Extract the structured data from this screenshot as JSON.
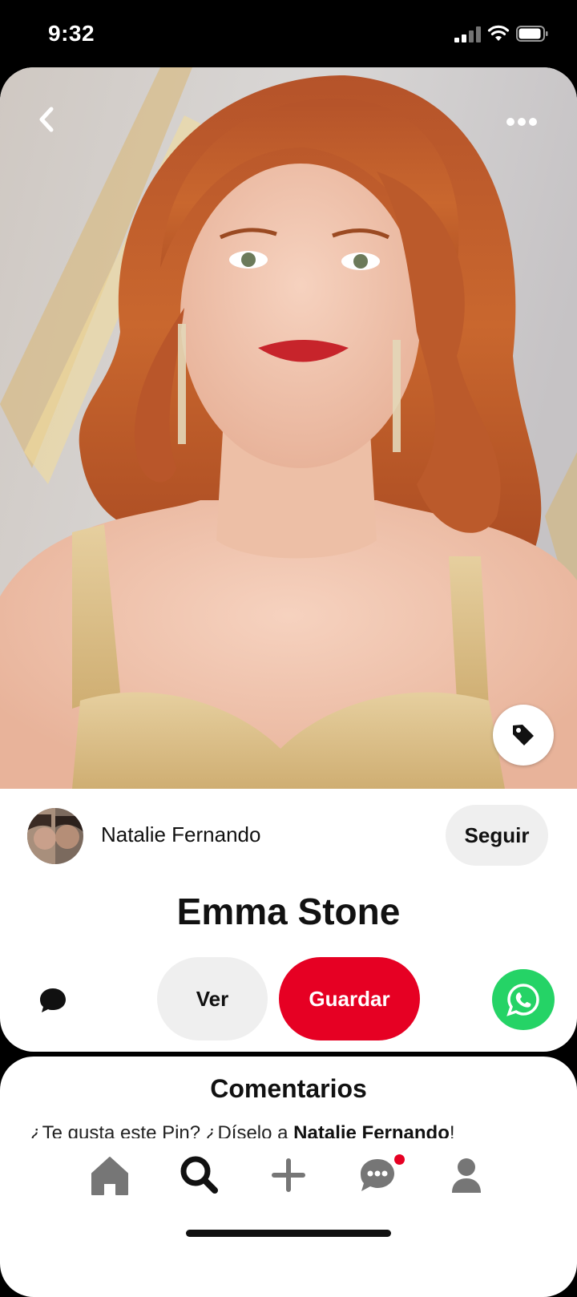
{
  "status_bar": {
    "time": "9:32"
  },
  "pin": {
    "image_alt": "Emma Stone",
    "title": "Emma Stone"
  },
  "author": {
    "name": "Natalie Fernando",
    "follow_label": "Seguir"
  },
  "actions": {
    "view_label": "Ver",
    "save_label": "Guardar"
  },
  "comments": {
    "title": "Comentarios",
    "prompt_prefix": "¿Te gusta este Pin? ¿Díselo a ",
    "prompt_name": "Natalie Fernando",
    "prompt_suffix": "!"
  },
  "tabbar": {
    "items": [
      "home-icon",
      "search-icon",
      "plus-icon",
      "chat-icon",
      "profile-icon"
    ],
    "chat_has_notification": true
  },
  "colors": {
    "accent": "#e60023",
    "whatsapp": "#25d366",
    "button_gray": "#efefef"
  }
}
